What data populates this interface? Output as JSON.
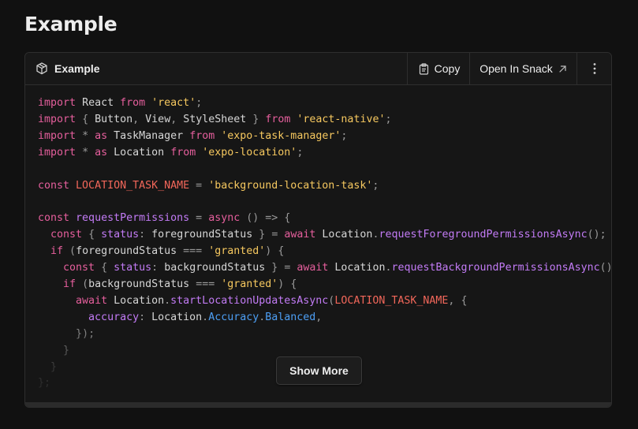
{
  "page": {
    "title": "Example"
  },
  "card": {
    "title": "Example",
    "title_icon": "snack-cube-icon",
    "copy_label": "Copy",
    "copy_icon": "clipboard-icon",
    "snack_label": "Open In Snack",
    "snack_icon": "arrow-up-right-icon",
    "more_icon": "vertical-dots-icon"
  },
  "code": {
    "language": "javascript",
    "lines": [
      "import React from 'react';",
      "import { Button, View, StyleSheet } from 'react-native';",
      "import * as TaskManager from 'expo-task-manager';",
      "import * as Location from 'expo-location';",
      "",
      "const LOCATION_TASK_NAME = 'background-location-task';",
      "",
      "const requestPermissions = async () => {",
      "  const { status: foregroundStatus } = await Location.requestForegroundPermissionsAsync();",
      "  if (foregroundStatus === 'granted') {",
      "    const { status: backgroundStatus } = await Location.requestBackgroundPermissionsAsync();",
      "    if (backgroundStatus === 'granted') {",
      "      await Location.startLocationUpdatesAsync(LOCATION_TASK_NAME, {",
      "        accuracy: Location.Accuracy.Balanced,",
      "      });",
      "    }",
      "  }",
      "};"
    ]
  },
  "show_more_label": "Show More",
  "colors": {
    "background": "#111111",
    "keyword": "#e65f9d",
    "string": "#f6c85f",
    "constant": "#f2675a",
    "function": "#c27bf5",
    "type": "#4d9ff5"
  }
}
